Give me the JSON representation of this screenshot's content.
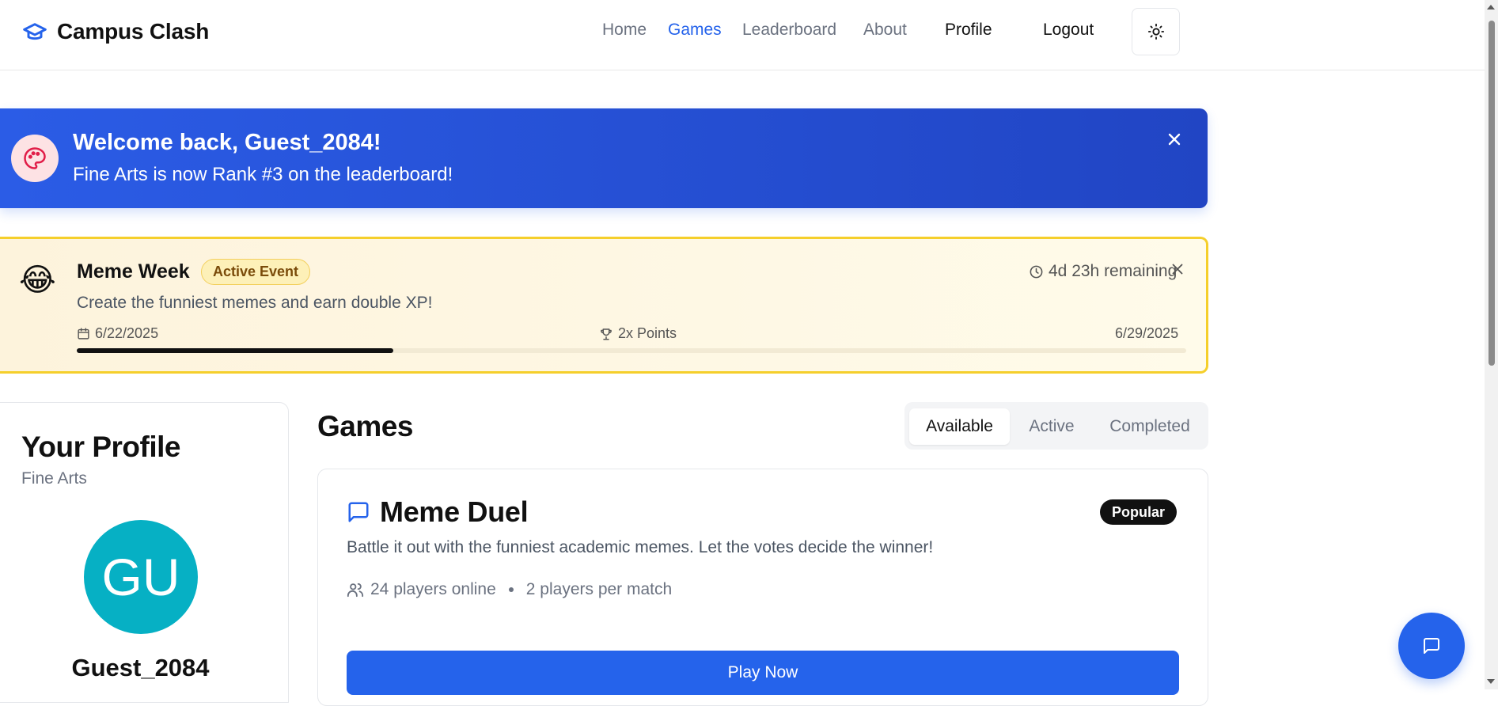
{
  "header": {
    "brand": "Campus Clash",
    "nav": [
      "Home",
      "Games",
      "Leaderboard",
      "About"
    ],
    "active_nav": "Games",
    "profile_label": "Profile",
    "logout_label": "Logout",
    "theme_icon": "sun-icon"
  },
  "welcome": {
    "title": "Welcome back, Guest_2084!",
    "subtitle": "Fine Arts is now Rank #3 on the leaderboard!",
    "icon": "palette-icon"
  },
  "event": {
    "emoji": "😂",
    "title": "Meme Week",
    "badge": "Active Event",
    "remaining": "4d 23h remaining",
    "description": "Create the funniest memes and earn double XP!",
    "start_date": "6/22/2025",
    "bonus": "2x Points",
    "end_date": "6/29/2025",
    "progress_fraction": 0.285
  },
  "profile": {
    "title": "Your Profile",
    "department": "Fine Arts",
    "initials": "GU",
    "username": "Guest_2084",
    "avatar_color": "#06b0c4"
  },
  "games": {
    "title": "Games",
    "tabs": [
      "Available",
      "Active",
      "Completed"
    ],
    "selected_tab": "Available",
    "cards": [
      {
        "title": "Meme Duel",
        "badge": "Popular",
        "description": "Battle it out with the funniest academic memes. Let the votes decide the winner!",
        "players_online": "24 players online",
        "players_per_match": "2 players per match",
        "cta": "Play Now",
        "icon": "message-square-icon"
      }
    ]
  },
  "colors": {
    "accent": "#2563eb",
    "event_border": "#f5cf2b"
  }
}
